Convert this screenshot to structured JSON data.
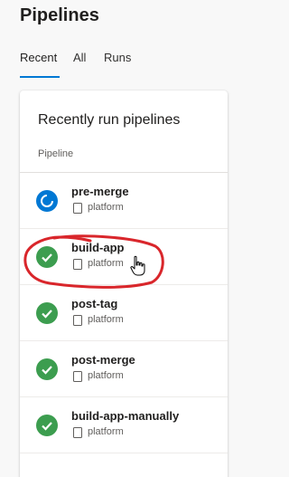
{
  "page_title": "Pipelines",
  "tabs": [
    {
      "label": "Recent",
      "active": true
    },
    {
      "label": "All",
      "active": false
    },
    {
      "label": "Runs",
      "active": false
    }
  ],
  "card": {
    "title": "Recently run pipelines",
    "column_header": "Pipeline"
  },
  "pipelines": [
    {
      "name": "pre-merge",
      "repo": "platform",
      "status": "running"
    },
    {
      "name": "build-app",
      "repo": "platform",
      "status": "success"
    },
    {
      "name": "post-tag",
      "repo": "platform",
      "status": "success"
    },
    {
      "name": "post-merge",
      "repo": "platform",
      "status": "success"
    },
    {
      "name": "build-app-manually",
      "repo": "platform",
      "status": "success"
    }
  ],
  "colors": {
    "accent": "#0078d4",
    "success": "#3c9d4f",
    "annotation": "#d9262b"
  }
}
